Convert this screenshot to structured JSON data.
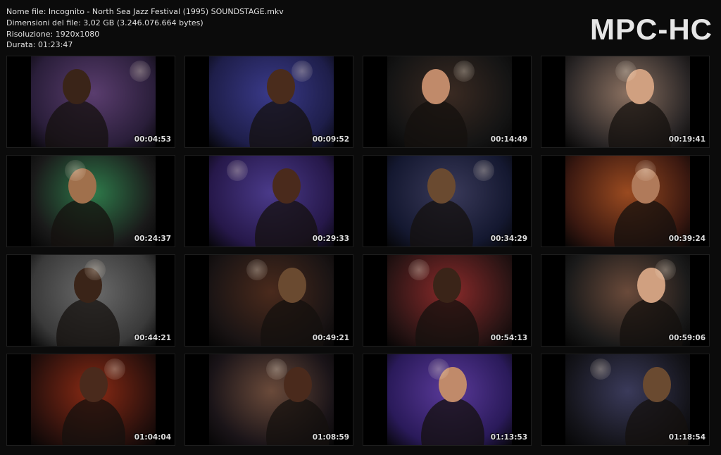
{
  "file_info": {
    "name_line": "Nome file: Incognito - North Sea Jazz Festival (1995) SOUNDSTAGE.mkv",
    "size_line": "Dimensioni del file: 3,02 GB (3.246.076.664 bytes)",
    "resolution_line": "Risoluzione: 1920x1080",
    "duration_line": "Durata: 01:23:47"
  },
  "logo": "MPC-HC",
  "thumbnails": [
    {
      "time": "00:04:53",
      "bg": "#2a1e3a",
      "accent": "#5a3d6e",
      "skin": "#3a2418"
    },
    {
      "time": "00:09:52",
      "bg": "#1e1e4a",
      "accent": "#3a3a8a",
      "skin": "#4a2c1c"
    },
    {
      "time": "00:14:49",
      "bg": "#141414",
      "accent": "#3a2a22",
      "skin": "#c08a6a"
    },
    {
      "time": "00:19:41",
      "bg": "#2a2626",
      "accent": "#8a7060",
      "skin": "#d0a080"
    },
    {
      "time": "00:24:37",
      "bg": "#1a1a1a",
      "accent": "#2e7a4a",
      "skin": "#a0704c"
    },
    {
      "time": "00:29:33",
      "bg": "#26184a",
      "accent": "#4a3a8a",
      "skin": "#4a2a1c"
    },
    {
      "time": "00:34:29",
      "bg": "#141830",
      "accent": "#3a3a5a",
      "skin": "#6a4a30"
    },
    {
      "time": "00:39:24",
      "bg": "#3a1810",
      "accent": "#9a4a20",
      "skin": "#b07a5a"
    },
    {
      "time": "00:44:21",
      "bg": "#3a3a3a",
      "accent": "#6a6a6a",
      "skin": "#3a2418"
    },
    {
      "time": "00:49:21",
      "bg": "#1a1414",
      "accent": "#4a2a1c",
      "skin": "#6a4a30"
    },
    {
      "time": "00:54:13",
      "bg": "#2a1414",
      "accent": "#8a2a2a",
      "skin": "#3a2418"
    },
    {
      "time": "00:59:06",
      "bg": "#1a1a1a",
      "accent": "#6a4a3a",
      "skin": "#d0a080"
    },
    {
      "time": "01:04:04",
      "bg": "#2a100c",
      "accent": "#8a2a14",
      "skin": "#4a2a1c"
    },
    {
      "time": "01:08:59",
      "bg": "#1a1418",
      "accent": "#6a4a3a",
      "skin": "#4a2a1c"
    },
    {
      "time": "01:13:53",
      "bg": "#2a1a5a",
      "accent": "#5a3a9a",
      "skin": "#c08a6a"
    },
    {
      "time": "01:18:54",
      "bg": "#14141a",
      "accent": "#3a3a5a",
      "skin": "#6a4a30"
    }
  ]
}
